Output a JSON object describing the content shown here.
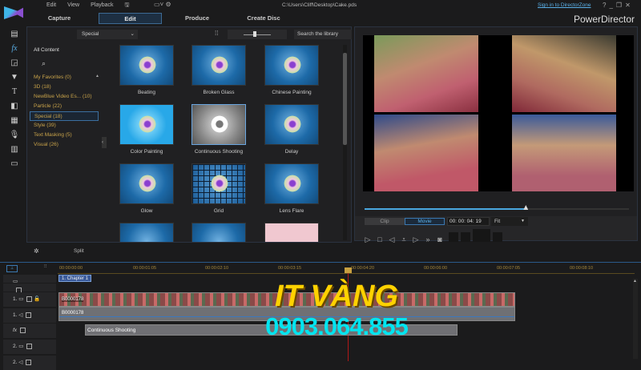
{
  "menu": [
    "Edit",
    "View",
    "Playback"
  ],
  "file_path": "C:\\Users\\Cliff\\Desktop\\Cake.pds",
  "sign_in": "Sign in to DirectorZone",
  "app_name": "PowerDirector",
  "window_controls": [
    "?",
    "_",
    "❐",
    "✕"
  ],
  "tabs": [
    {
      "label": "Capture"
    },
    {
      "label": "Edit",
      "active": true
    },
    {
      "label": "Produce"
    },
    {
      "label": "Create Disc"
    }
  ],
  "library": {
    "dropdown": "Special",
    "search_placeholder": "Search the library",
    "all_content": "All Content",
    "categories": [
      "My Favorites  (0)",
      "3D  (18)",
      "NewBlue Video Es...  (10)",
      "Particle  (22)",
      "Special  (18)",
      "Style  (39)",
      "Text Masking  (5)",
      "Visual  (26)"
    ],
    "selected_category": "Special  (18)",
    "effects": [
      "Beating",
      "Broken Glass",
      "Chinese Painting",
      "Color Painting",
      "Continuous Shooting",
      "Delay",
      "Glow",
      "Grid",
      "Lens Flare"
    ],
    "selected_effect": "Continuous Shooting"
  },
  "preview": {
    "mode_clip": "Clip",
    "mode_movie": "Movie",
    "active_mode": "Movie",
    "timecode": "00: 00: 04: 19",
    "fit": "Fit",
    "progress": 0.61
  },
  "timeline": {
    "split": "Split",
    "ruler": [
      "00:00:00:00",
      "00:00:01:05",
      "00:00:02:10",
      "00:00:03:15",
      "00:00:04:20",
      "00:00:06:00",
      "00:00:07:05",
      "00:00:08:10"
    ],
    "chapter": "1. Chapter 1",
    "video_clip": "B0000178",
    "audio_clip": "B0000178",
    "fx_clip": "Continuous Shooting",
    "track_labels": [
      "1.",
      "1.",
      "fx",
      "2.",
      "2."
    ]
  },
  "watermark": {
    "brand": "IT VÀNG",
    "phone": "0903.064.855",
    "brand_color": "#ffd200",
    "phone_color": "#00e5f0"
  },
  "colors": {
    "accent": "#3d8fd0",
    "ruler": "#a8893a",
    "category": "#c9a34a"
  }
}
